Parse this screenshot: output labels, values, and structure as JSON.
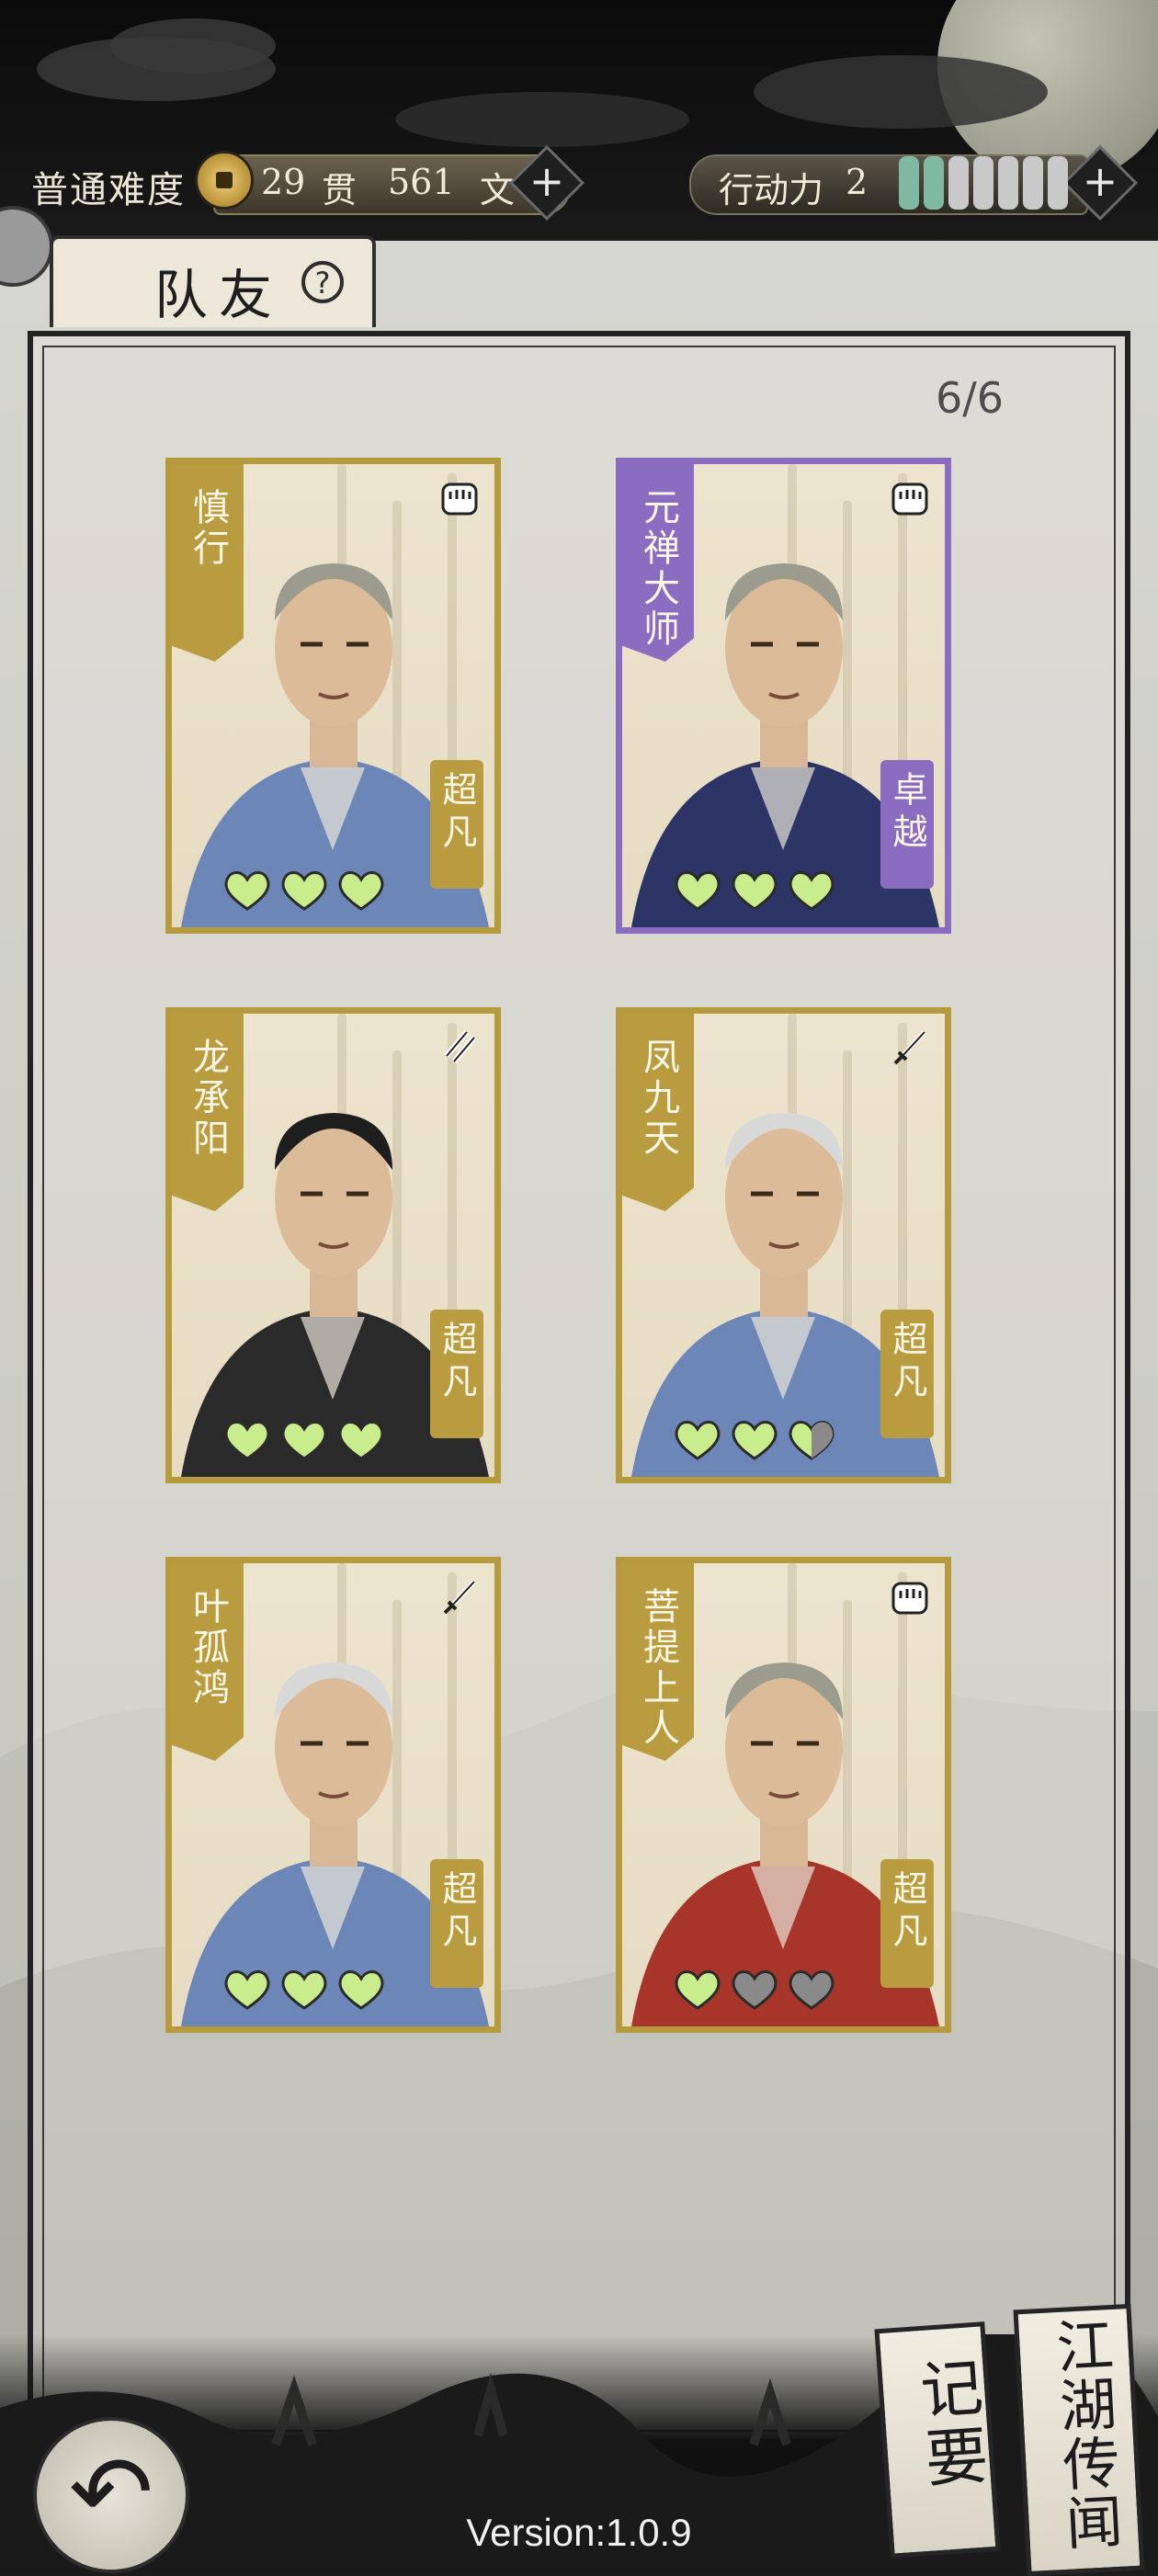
{
  "hud": {
    "difficulty": "普通难度",
    "money_guan": "29",
    "money_guan_unit": "贯",
    "money_wen": "561",
    "money_wen_unit": "文",
    "plus": "+",
    "action_label": "行动力",
    "action_value": "2",
    "action_points": {
      "filled": 2,
      "total": 7
    }
  },
  "panel": {
    "tab_title": "队友",
    "help": "?",
    "count": "6/6"
  },
  "cards": [
    {
      "name": "慎行",
      "rank": "超凡",
      "weapon": "fist-icon",
      "color": "gold",
      "hearts": [
        "full",
        "full",
        "full"
      ]
    },
    {
      "name": "元禅大师",
      "rank": "卓越",
      "weapon": "fist-icon",
      "color": "purple",
      "hearts": [
        "full",
        "full",
        "full"
      ]
    },
    {
      "name": "龙承阳",
      "rank": "超凡",
      "weapon": "twin-blades-icon",
      "color": "gold",
      "hearts": [
        "full",
        "full",
        "full"
      ]
    },
    {
      "name": "凤九天",
      "rank": "超凡",
      "weapon": "sword-icon",
      "color": "gold",
      "hearts": [
        "full",
        "full",
        "half"
      ]
    },
    {
      "name": "叶孤鸿",
      "rank": "超凡",
      "weapon": "sword-icon",
      "color": "gold",
      "hearts": [
        "full",
        "full",
        "full"
      ]
    },
    {
      "name": "菩提上人",
      "rank": "超凡",
      "weapon": "fist-icon",
      "color": "gold",
      "hearts": [
        "full",
        "empty",
        "empty"
      ]
    }
  ],
  "bottom": {
    "back": "↶",
    "notes": "记要",
    "rumors": "江湖传闻",
    "version": "Version:1.0.9"
  },
  "colors": {
    "gold": "#b99c3f",
    "purple": "#8a6cc0",
    "heart_full": "#c9ec8c",
    "heart_empty": "#8a8a8a",
    "ap_filled": "#7fb9a2",
    "ap_empty": "#c9c9c9"
  }
}
